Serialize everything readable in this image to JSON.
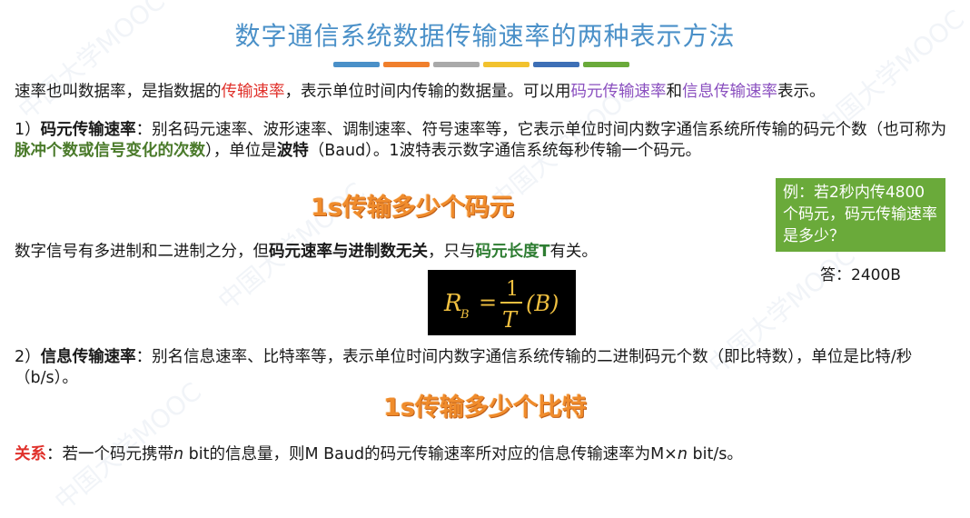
{
  "title": "数字通信系统数据传输速率的两种表示方法",
  "title_bar_colors": [
    "#4a90c8",
    "#f07f2c",
    "#a9a9a9",
    "#f2c22e",
    "#3d6fb6",
    "#6aaa3a"
  ],
  "intro": {
    "t1": "速率也叫数据率，是指数据的",
    "h1": "传输速率",
    "t2": "，表示单位时间内传输的数据量。可以用",
    "h2": "码元传输速率",
    "t3": "和",
    "h3": "信息传输速率",
    "t4": "表示。"
  },
  "code_rate": {
    "prefix": "1）",
    "term": "码元传输速率",
    "t1": "：别名码元速率、波形速率、调制速率、符号速率等，它表示单位时间内数字通信系统所传输的码元个数（也可称为",
    "h1": "脉冲个数或信号变化的次数",
    "t2": "），单位是",
    "h2": "波特",
    "t3": "（Baud）。1波特表示数字通信系统每秒传输一个码元。"
  },
  "banner1": "1s传输多少个码元",
  "callout": {
    "question": "例：若2秒内传4800个码元，码元传输速率是多少？",
    "answer": "答：2400B"
  },
  "digital": {
    "t1": "数字信号有多进制和二进制之分，但",
    "h1": "码元速率与进制数无关",
    "t2": "，只与",
    "h2": "码元长度T",
    "t3": "有关。"
  },
  "formula": {
    "lhs": "R",
    "sub": "B",
    "eq": "=",
    "num": "1",
    "den": "T",
    "unit": "(B)"
  },
  "info_rate": {
    "prefix": "2）",
    "term": "信息传输速率",
    "t1": "：别名信息速率、比特率等，表示单位时间内数字通信系统传输的二进制码元个数（即比特数），单位是比特/秒（b/s）。"
  },
  "banner2": "1s传输多少个比特",
  "relation": {
    "label": "关系",
    "t1": "：若一个码元携带",
    "n1": "n",
    "t2": " bit的信息量，则M Baud的码元传输速率所对应的信息传输速率为M×",
    "n2": "n",
    "t3": " bit/s。"
  },
  "watermark_text": "中国大学MOOC"
}
